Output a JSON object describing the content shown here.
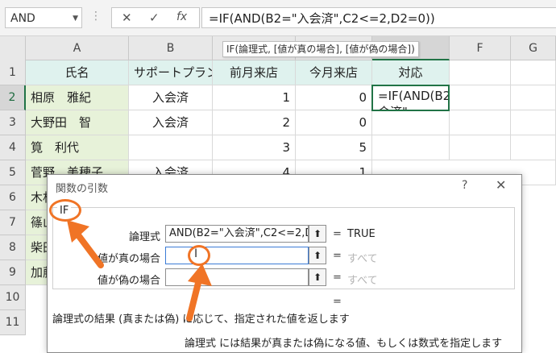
{
  "formula_bar": {
    "name_box": "AND",
    "cancel_icon": "✕",
    "enter_icon": "✓",
    "fx_label": "fx",
    "formula": "=IF(AND(B2=\"入会済\",C2<=2,D2=0))"
  },
  "tooltip": "IF(論理式, [値が真の場合], [値が偽の場合])",
  "columns": [
    "A",
    "B",
    "C",
    "D",
    "E",
    "F",
    "G"
  ],
  "rows": [
    "1",
    "2",
    "3",
    "4",
    "5",
    "6",
    "7",
    "8",
    "9",
    "10",
    "11"
  ],
  "header_row": [
    "氏名",
    "サポートプラン",
    "前月来店",
    "今月来店",
    "対応"
  ],
  "data_rows": [
    [
      "相原　雅紀",
      "入会済",
      "1",
      "0"
    ],
    [
      "大野田　智",
      "入会済",
      "2",
      "0"
    ],
    [
      "筧　利代",
      "",
      "3",
      "5"
    ],
    [
      "菅野　美穂子",
      "入会済",
      "4",
      "1"
    ]
  ],
  "partial_names": [
    "木村",
    "篠山",
    "柴田",
    "加藤"
  ],
  "active_cell_text": "=IF(AND(B2=\"入会済\"",
  "dialog": {
    "title": "関数の引数",
    "help": "?",
    "close": "✕",
    "function_name": "IF",
    "args": [
      {
        "label": "論理式",
        "value": "AND(B2=\"入会済\",C2<=2,D2",
        "result": "TRUE"
      },
      {
        "label": "値が真の場合",
        "value": "",
        "result": "すべて"
      },
      {
        "label": "値が偽の場合",
        "value": "",
        "result": "すべて"
      }
    ],
    "equals": "=",
    "arg_button": "⬆",
    "result_equals": "=",
    "description": "論理式の結果 (真または偽) に応じて、指定された値を返します",
    "arg_description": "論理式 には結果が真または偽になる値、もしくは数式を指定します"
  },
  "colors": {
    "accent": "#217346",
    "highlight": "#f07426"
  }
}
